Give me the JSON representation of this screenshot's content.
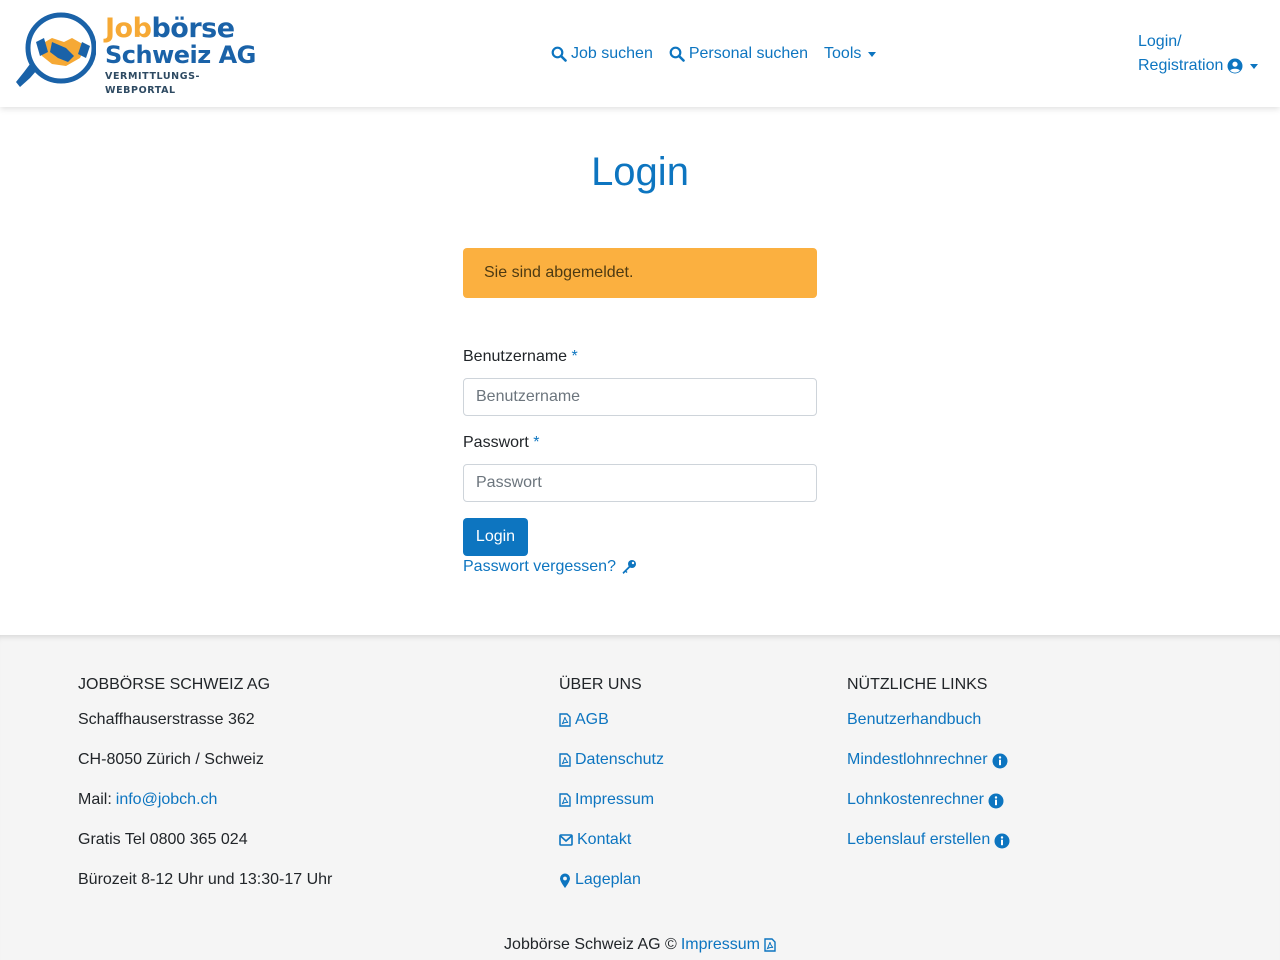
{
  "header": {
    "logo": {
      "line1a": "Job",
      "line1b": "börse",
      "line2": "Schweiz AG",
      "line3": "VERMITTLUNGS-WEBPORTAL"
    },
    "nav": {
      "job_search": "Job suchen",
      "personal_search": "Personal suchen",
      "tools": "Tools"
    },
    "login_line1": "Login/",
    "login_line2": "Registration"
  },
  "main": {
    "title": "Login",
    "alert": "Sie sind abgemeldet.",
    "username_label": "Benutzername",
    "username_placeholder": "Benutzername",
    "username_value": "",
    "password_label": "Passwort",
    "password_placeholder": "Passwort",
    "password_value": "",
    "required_mark": "*",
    "login_button": "Login",
    "forgot_password": "Passwort vergessen?"
  },
  "footer": {
    "company": {
      "heading": "JOBBÖRSE SCHWEIZ AG",
      "street": "Schaffhauserstrasse 362",
      "city": "CH-8050 Zürich / Schweiz",
      "mail_label": "Mail:",
      "mail": "info@jobch.ch",
      "phone": "Gratis Tel 0800 365 024",
      "hours": "Bürozeit 8-12 Uhr und 13:30-17 Uhr"
    },
    "about": {
      "heading": "ÜBER UNS",
      "items": [
        {
          "label": "AGB",
          "icon": "file-pdf-icon"
        },
        {
          "label": "Datenschutz",
          "icon": "file-pdf-icon"
        },
        {
          "label": "Impressum",
          "icon": "file-pdf-icon"
        },
        {
          "label": "Kontakt",
          "icon": "envelope-icon"
        },
        {
          "label": "Lageplan",
          "icon": "map-marker-icon"
        }
      ]
    },
    "links": {
      "heading": "NÜTZLICHE LINKS",
      "items": [
        {
          "label": "Benutzerhandbuch"
        },
        {
          "label": "Mindestlohnrechner",
          "icon": "info-circle-icon"
        },
        {
          "label": "Lohnkostenrechner",
          "icon": "info-circle-icon"
        },
        {
          "label": "Lebenslauf erstellen",
          "icon": "info-circle-icon"
        }
      ]
    },
    "bottom_text": "Jobbörse Schweiz AG ©",
    "bottom_link": "Impressum"
  },
  "colors": {
    "brand_blue": "#0d75c0",
    "alert_orange": "#fbb040",
    "logo_orange": "#f6a935",
    "logo_blue": "#1a62a8"
  }
}
